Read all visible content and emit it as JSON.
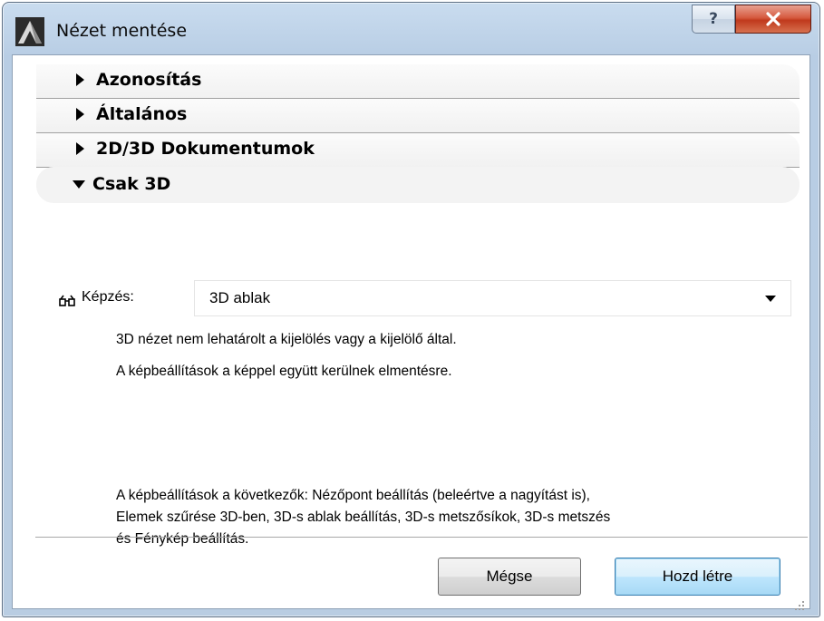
{
  "window": {
    "title": "Nézet mentése",
    "help_label": "?",
    "close_label": "X"
  },
  "sections": [
    {
      "label": "Azonosítás",
      "expanded": false
    },
    {
      "label": "Általános",
      "expanded": false
    },
    {
      "label": "2D/3D Dokumentumok",
      "expanded": false
    },
    {
      "label": "Csak 3D",
      "expanded": true
    }
  ],
  "field": {
    "icon": "glasses-icon",
    "label": "Képzés:",
    "value": "3D ablak"
  },
  "texts": {
    "line1": "3D nézet nem lehatárolt a kijelölés vagy a kijelölő által.",
    "line2": "A képbeállítások a képpel együtt kerülnek elmentésre.",
    "line3": "A képbeállítások a következők: Nézőpont beállítás (beleértve a nagyítást is),",
    "line4": "Elemek szűrése 3D-ben, 3D-s ablak beállítás, 3D-s metszősíkok, 3D-s metszés",
    "line5": "és Fénykép beállítás."
  },
  "buttons": {
    "cancel": "Mégse",
    "create": "Hozd létre"
  },
  "colors": {
    "titlebar": "#b9cde2",
    "close": "#c0391c",
    "default_button": "#3c7fb1"
  }
}
